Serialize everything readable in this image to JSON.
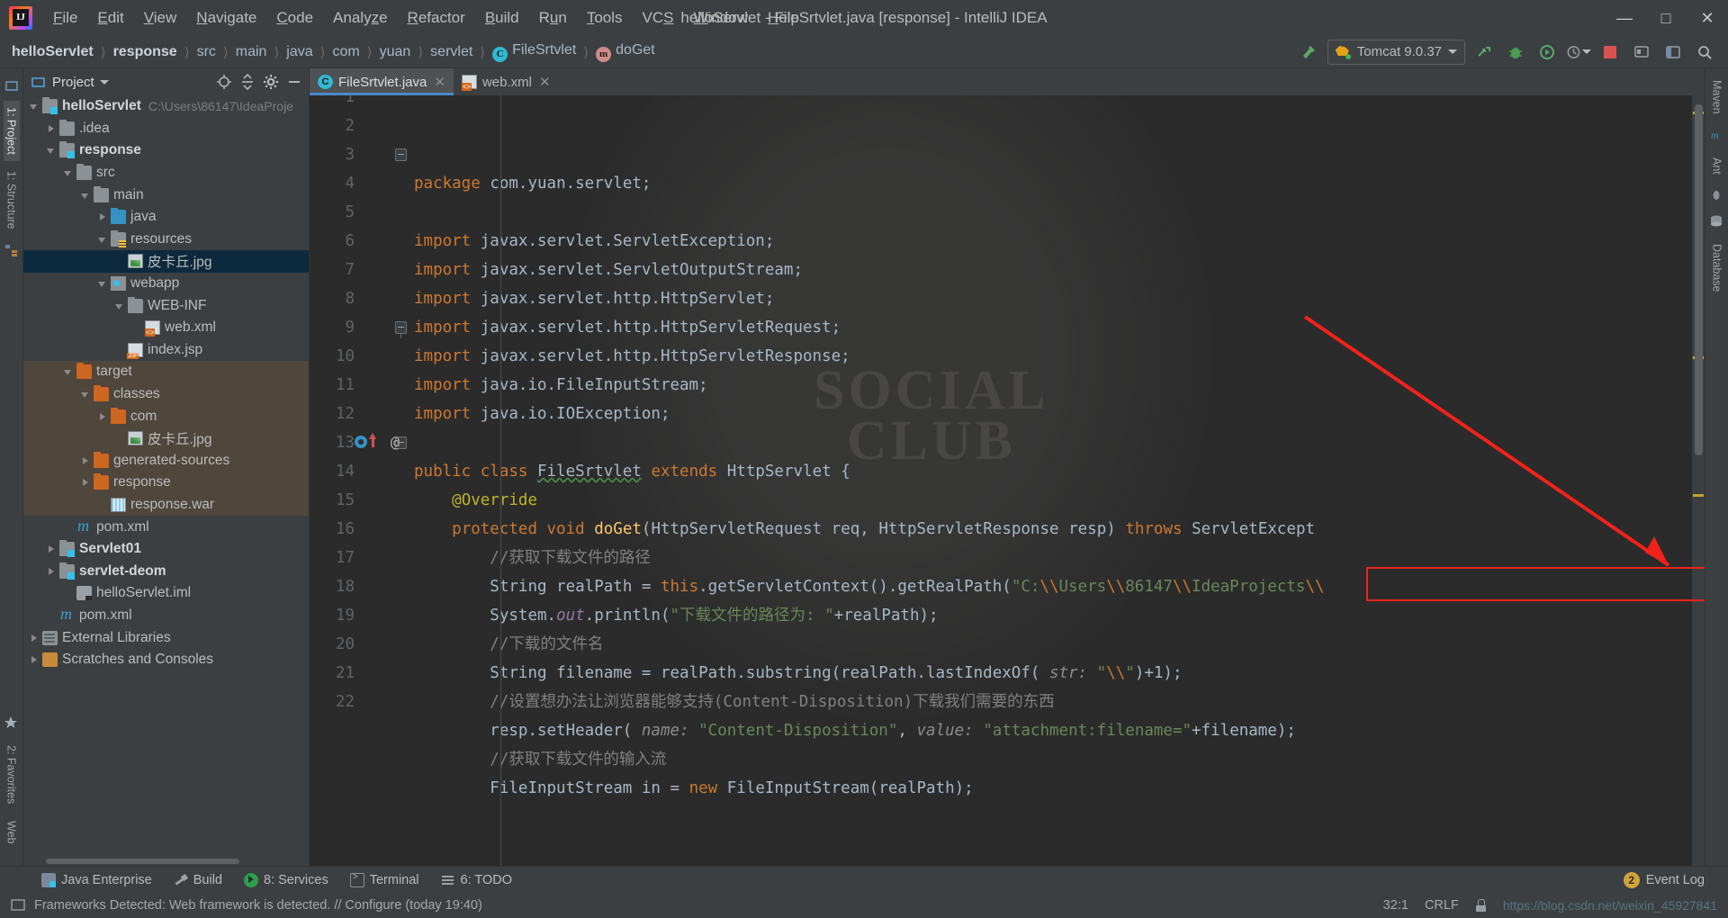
{
  "window": {
    "title": "helloServlet - FileSrtvlet.java [response] - IntelliJ IDEA",
    "minimize": "—",
    "maximize": "☐",
    "close": "✕"
  },
  "menu": [
    {
      "label": "File",
      "mnemonic": "F"
    },
    {
      "label": "Edit",
      "mnemonic": "E"
    },
    {
      "label": "View",
      "mnemonic": "V"
    },
    {
      "label": "Navigate",
      "mnemonic": "N"
    },
    {
      "label": "Code",
      "mnemonic": "C"
    },
    {
      "label": "Analyze",
      "mnemonic": "z"
    },
    {
      "label": "Refactor",
      "mnemonic": "R"
    },
    {
      "label": "Build",
      "mnemonic": "B"
    },
    {
      "label": "Run",
      "mnemonic": "u"
    },
    {
      "label": "Tools",
      "mnemonic": "T"
    },
    {
      "label": "VCS",
      "mnemonic": "S"
    },
    {
      "label": "Window",
      "mnemonic": "W"
    },
    {
      "label": "Help",
      "mnemonic": "H"
    }
  ],
  "breadcrumbs": [
    {
      "label": "helloServlet",
      "bold": true,
      "icon": ""
    },
    {
      "label": "response",
      "bold": true,
      "icon": ""
    },
    {
      "label": "src",
      "bold": false,
      "icon": ""
    },
    {
      "label": "main",
      "bold": false,
      "icon": ""
    },
    {
      "label": "java",
      "bold": false,
      "icon": ""
    },
    {
      "label": "com",
      "bold": false,
      "icon": ""
    },
    {
      "label": "yuan",
      "bold": false,
      "icon": ""
    },
    {
      "label": "servlet",
      "bold": false,
      "icon": ""
    },
    {
      "label": "FileSrtvlet",
      "bold": false,
      "icon": "class-icon"
    },
    {
      "label": "doGet",
      "bold": false,
      "icon": "method-icon"
    }
  ],
  "toolbar": {
    "build_icon": "hammer-icon",
    "run_config": "Tomcat 9.0.37",
    "run_config_icon": "tomcat-icon",
    "dropdown_icon": "chevron-down-icon",
    "run_icon": "run-icon",
    "debug_icon": "debug-icon",
    "run_coverage_icon": "run-with-coverage-icon",
    "profiler_icon": "profiler-icon",
    "stop_icon": "stop-icon",
    "updates_icon": "updates-icon",
    "layout_icon": "restore-layout-icon",
    "search_icon": "search-icon"
  },
  "left_rail": [
    {
      "label": "1: Project",
      "active": true,
      "name": "tool-window-project"
    },
    {
      "label": "1: Structure",
      "active": false,
      "name": "tool-window-structure"
    },
    {
      "label": "2: Favorites",
      "active": false,
      "name": "tool-window-favorites"
    },
    {
      "label": "Web",
      "active": false,
      "name": "tool-window-web"
    }
  ],
  "right_rail": [
    {
      "label": "Maven",
      "name": "tool-window-maven"
    },
    {
      "label": "Ant",
      "name": "tool-window-ant"
    },
    {
      "label": "Database",
      "name": "tool-window-database"
    }
  ],
  "project_panel": {
    "title": "Project",
    "dropdown_icon": "chevron-down-icon",
    "locate_icon": "scroll-from-source-icon",
    "collapse_icon": "collapse-all-icon",
    "settings_icon": "gear-icon",
    "hide_icon": "hide-icon",
    "tree": [
      {
        "label": "helloServlet",
        "path": "C:\\Users\\86147\\IdeaProje",
        "indent": 0,
        "arrow": "down",
        "icon": "module-folder-icon",
        "bold": true,
        "state": "normal"
      },
      {
        "label": ".idea",
        "path": "",
        "indent": 1,
        "arrow": "right",
        "icon": "folder-icon",
        "bold": false,
        "state": "normal"
      },
      {
        "label": "response",
        "path": "",
        "indent": 1,
        "arrow": "down",
        "icon": "module-folder-icon",
        "bold": true,
        "state": "normal"
      },
      {
        "label": "src",
        "path": "",
        "indent": 2,
        "arrow": "down",
        "icon": "folder-icon",
        "bold": false,
        "state": "normal"
      },
      {
        "label": "main",
        "path": "",
        "indent": 3,
        "arrow": "down",
        "icon": "folder-icon",
        "bold": false,
        "state": "normal"
      },
      {
        "label": "java",
        "path": "",
        "indent": 4,
        "arrow": "right",
        "icon": "source-folder-icon",
        "bold": false,
        "state": "normal"
      },
      {
        "label": "resources",
        "path": "",
        "indent": 4,
        "arrow": "down",
        "icon": "resources-folder-icon",
        "bold": false,
        "state": "normal"
      },
      {
        "label": "皮卡丘.jpg",
        "path": "",
        "indent": 5,
        "arrow": "none",
        "icon": "image-file-icon",
        "bold": false,
        "state": "selected"
      },
      {
        "label": "webapp",
        "path": "",
        "indent": 4,
        "arrow": "down",
        "icon": "webapp-folder-icon",
        "bold": false,
        "state": "normal"
      },
      {
        "label": "WEB-INF",
        "path": "",
        "indent": 5,
        "arrow": "down",
        "icon": "folder-icon",
        "bold": false,
        "state": "normal"
      },
      {
        "label": "web.xml",
        "path": "",
        "indent": 6,
        "arrow": "none",
        "icon": "xml-file-icon",
        "bold": false,
        "state": "normal"
      },
      {
        "label": "index.jsp",
        "path": "",
        "indent": 5,
        "arrow": "none",
        "icon": "jsp-file-icon",
        "bold": false,
        "state": "normal"
      },
      {
        "label": "target",
        "path": "",
        "indent": 2,
        "arrow": "down",
        "icon": "excluded-folder-icon",
        "bold": false,
        "state": "excluded"
      },
      {
        "label": "classes",
        "path": "",
        "indent": 3,
        "arrow": "down",
        "icon": "excluded-folder-icon",
        "bold": false,
        "state": "excluded"
      },
      {
        "label": "com",
        "path": "",
        "indent": 4,
        "arrow": "right",
        "icon": "excluded-folder-icon",
        "bold": false,
        "state": "excluded"
      },
      {
        "label": "皮卡丘.jpg",
        "path": "",
        "indent": 5,
        "arrow": "none",
        "icon": "image-file-icon",
        "bold": false,
        "state": "excluded"
      },
      {
        "label": "generated-sources",
        "path": "",
        "indent": 3,
        "arrow": "right",
        "icon": "excluded-folder-icon",
        "bold": false,
        "state": "excluded"
      },
      {
        "label": "response",
        "path": "",
        "indent": 3,
        "arrow": "right",
        "icon": "excluded-folder-icon",
        "bold": false,
        "state": "excluded"
      },
      {
        "label": "response.war",
        "path": "",
        "indent": 4,
        "arrow": "none",
        "icon": "war-file-icon",
        "bold": false,
        "state": "excluded"
      },
      {
        "label": "pom.xml",
        "path": "",
        "indent": 2,
        "arrow": "none",
        "icon": "maven-file-icon",
        "bold": false,
        "state": "normal"
      },
      {
        "label": "Servlet01",
        "path": "",
        "indent": 1,
        "arrow": "right",
        "icon": "module-folder-icon",
        "bold": true,
        "state": "normal"
      },
      {
        "label": "servlet-deom",
        "path": "",
        "indent": 1,
        "arrow": "right",
        "icon": "module-folder-icon",
        "bold": true,
        "state": "normal"
      },
      {
        "label": "helloServlet.iml",
        "path": "",
        "indent": 2,
        "arrow": "none",
        "icon": "iml-file-icon",
        "bold": false,
        "state": "normal"
      },
      {
        "label": "pom.xml",
        "path": "",
        "indent": 1,
        "arrow": "none",
        "icon": "maven-file-icon",
        "bold": false,
        "state": "normal"
      },
      {
        "label": "External Libraries",
        "path": "",
        "indent": 0,
        "arrow": "right",
        "icon": "library-icon",
        "bold": false,
        "state": "normal"
      },
      {
        "label": "Scratches and Consoles",
        "path": "",
        "indent": 0,
        "arrow": "right",
        "icon": "scratch-icon",
        "bold": false,
        "state": "normal"
      }
    ]
  },
  "editor": {
    "tabs": [
      {
        "label": "FileSrtvlet.java",
        "icon": "java-class-icon",
        "active": true,
        "close": "✕"
      },
      {
        "label": "web.xml",
        "icon": "xml-file-icon",
        "active": false,
        "close": "✕"
      }
    ],
    "first_visible_line": 1,
    "lines": [
      {
        "n": 1,
        "fold": "none",
        "html": "<span class=\"kw\">package</span> <span class=\"pln\">com.yuan.servlet;</span>"
      },
      {
        "n": 2,
        "fold": "none",
        "html": ""
      },
      {
        "n": 3,
        "fold": "head",
        "html": "<span class=\"kw\">import</span> <span class=\"pln\">javax.servlet.ServletException;</span>"
      },
      {
        "n": 4,
        "fold": "none",
        "html": "<span class=\"kw\">import</span> <span class=\"pln\">javax.servlet.ServletOutputStream;</span>"
      },
      {
        "n": 5,
        "fold": "none",
        "html": "<span class=\"kw\">import</span> <span class=\"pln\">javax.servlet.http.HttpServlet;</span>"
      },
      {
        "n": 6,
        "fold": "none",
        "html": "<span class=\"kw\">import</span> <span class=\"pln\">javax.servlet.http.HttpServletRequest;</span>"
      },
      {
        "n": 7,
        "fold": "none",
        "html": "<span class=\"kw\">import</span> <span class=\"pln\">javax.servlet.http.HttpServletResponse;</span>"
      },
      {
        "n": 8,
        "fold": "none",
        "html": "<span class=\"kw\">import</span> <span class=\"pln\">java.io.FileInputStream;</span>"
      },
      {
        "n": 9,
        "fold": "tail",
        "html": "<span class=\"kw\">import</span> <span class=\"pln\">java.io.IOException;</span>"
      },
      {
        "n": 10,
        "fold": "none",
        "html": ""
      },
      {
        "n": 11,
        "fold": "none",
        "html": "<span class=\"kw\">public class</span> <span class=\"typ sqg\">FileSrtvlet</span> <span class=\"kw\">extends</span> <span class=\"typ\">HttpServlet</span> <span class=\"pln\">{</span>"
      },
      {
        "n": 12,
        "fold": "none",
        "html": "    <span class=\"anno\">@Override</span>"
      },
      {
        "n": 13,
        "fold": "head",
        "html": "    <span class=\"kw\">protected void</span> <span class=\"mth\">doGet</span><span class=\"pln\">(</span><span class=\"typ\">HttpServletRequest</span> <span class=\"pln\">req,</span> <span class=\"typ\">HttpServletResponse</span> <span class=\"pln\">resp)</span> <span class=\"kw\">throws</span> <span class=\"typ\">ServletExcept</span>"
      },
      {
        "n": 14,
        "fold": "none",
        "html": "        <span class=\"cmt\">//获取下载文件的路径</span>"
      },
      {
        "n": 15,
        "fold": "none",
        "html": "        <span class=\"typ\">String</span> <span class=\"pln\">realPath =</span> <span class=\"kw\">this</span><span class=\"pln\">.getServletContext().getRealPath(</span><span class=\"str\">\"C:</span><span class=\"esc\">\\\\</span><span class=\"str\">Users</span><span class=\"esc\">\\\\</span><span class=\"str\">86147</span><span class=\"esc\">\\\\</span><span class=\"str\">IdeaProjects</span><span class=\"esc\">\\\\</span>"
      },
      {
        "n": 16,
        "fold": "none",
        "html": "        <span class=\"typ\">System</span><span class=\"pln\">.</span><span class=\"fld\">out</span><span class=\"pln\">.println(</span><span class=\"str\">\"下载文件的路径为: \"</span><span class=\"pln\">+realPath);</span>"
      },
      {
        "n": 17,
        "fold": "none",
        "html": "        <span class=\"cmt\">//下载的文件名</span>"
      },
      {
        "n": 18,
        "fold": "none",
        "html": "        <span class=\"typ\">String</span> <span class=\"pln\">filename = realPath.substring(realPath.lastIndexOf(</span> <span class=\"hint\">str:</span> <span class=\"str\">\"</span><span class=\"esc\">\\\\</span><span class=\"str\">\"</span><span class=\"pln\">)+1);</span>"
      },
      {
        "n": 19,
        "fold": "none",
        "html": "        <span class=\"cmt\">//设置想办法让浏览器能够支持(Content-Disposition)下载我们需要的东西</span>"
      },
      {
        "n": 20,
        "fold": "none",
        "html": "        <span class=\"pln\">resp.setHeader(</span> <span class=\"hint\">name:</span> <span class=\"str\">\"Content-Disposition\"</span><span class=\"pln\">,</span> <span class=\"hint\">value:</span> <span class=\"str\">\"attachment:filename=\"</span><span class=\"pln\">+filename);</span>"
      },
      {
        "n": 21,
        "fold": "none",
        "html": "        <span class=\"cmt\">//获取下载文件的输入流</span>"
      },
      {
        "n": 22,
        "fold": "none",
        "html": "        <span class=\"typ\">FileInputStream</span> <span class=\"pln\">in =</span> <span class=\"kw\">new</span> <span class=\"typ\">FileInputStream</span><span class=\"pln\">(realPath);</span>"
      }
    ],
    "highlight_box": {
      "line": 15,
      "text": "\"C:\\\\Users\\\\86147\\\\IdeaProjects\\\\",
      "color": "#f0221b"
    },
    "annotation_arrow_color": "#f0221b"
  },
  "bottom_tools": [
    {
      "label": "Java Enterprise",
      "icon": "java-enterprise-icon",
      "name": "tool-window-java-enterprise"
    },
    {
      "label": "Build",
      "icon": "hammer-icon",
      "name": "tool-window-build"
    },
    {
      "label": "8: Services",
      "icon": "services-icon",
      "name": "tool-window-services"
    },
    {
      "label": "Terminal",
      "icon": "terminal-icon",
      "name": "tool-window-terminal"
    },
    {
      "label": "6: TODO",
      "icon": "todo-icon",
      "name": "tool-window-todo"
    }
  ],
  "event_log": {
    "label": "Event Log",
    "count": "2"
  },
  "status": {
    "message": "Frameworks Detected: Web framework is detected. // Configure (today 19:40)",
    "caret": "32:1",
    "encoding": "CRLF",
    "watermark_url": "https://blog.csdn.net/weixin_45927841",
    "lock_icon": "lock-icon"
  }
}
